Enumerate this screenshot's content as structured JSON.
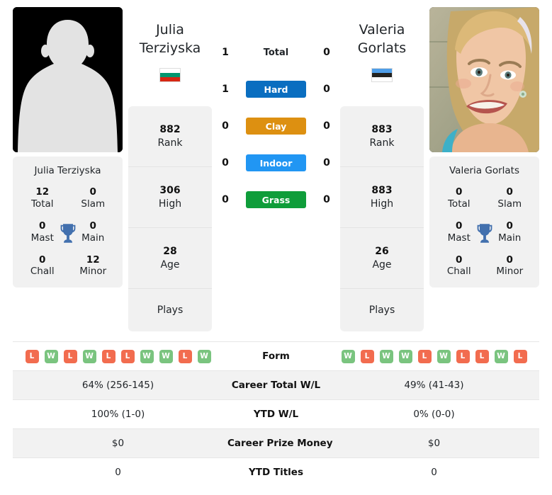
{
  "players": {
    "left": {
      "first_name": "Julia",
      "last_name": "Terziyska",
      "full_name": "Julia Terziyska",
      "country": "Bulgaria",
      "flag_icon": "flag-bulgaria-icon",
      "photo_type": "placeholder-avatar",
      "rank": "882",
      "rank_label": "Rank",
      "high": "306",
      "high_label": "High",
      "age": "28",
      "age_label": "Age",
      "plays_label": "Plays",
      "titles": {
        "total": "12",
        "total_label": "Total",
        "slam": "0",
        "slam_label": "Slam",
        "mast": "0",
        "mast_label": "Mast",
        "main": "0",
        "main_label": "Main",
        "chall": "0",
        "chall_label": "Chall",
        "minor": "12",
        "minor_label": "Minor"
      },
      "form": [
        "L",
        "W",
        "L",
        "W",
        "L",
        "L",
        "W",
        "W",
        "L",
        "W"
      ],
      "career_total_wl": "64% (256-145)",
      "ytd_wl": "100% (1-0)",
      "career_prize_money": "$0",
      "ytd_titles": "0"
    },
    "right": {
      "first_name": "Valeria",
      "last_name": "Gorlats",
      "full_name": "Valeria Gorlats",
      "country": "Estonia",
      "flag_icon": "flag-estonia-icon",
      "photo_type": "player-photo",
      "rank": "883",
      "rank_label": "Rank",
      "high": "883",
      "high_label": "High",
      "age": "26",
      "age_label": "Age",
      "plays_label": "Plays",
      "titles": {
        "total": "0",
        "total_label": "Total",
        "slam": "0",
        "slam_label": "Slam",
        "mast": "0",
        "mast_label": "Mast",
        "main": "0",
        "main_label": "Main",
        "chall": "0",
        "chall_label": "Chall",
        "minor": "0",
        "minor_label": "Minor"
      },
      "form": [
        "W",
        "L",
        "W",
        "W",
        "L",
        "W",
        "L",
        "L",
        "W",
        "L"
      ],
      "career_total_wl": "49% (41-43)",
      "ytd_wl": "0% (0-0)",
      "career_prize_money": "$0",
      "ytd_titles": "0"
    }
  },
  "head_to_head": {
    "rows": [
      {
        "key": "total",
        "label": "Total",
        "left": "1",
        "right": "0",
        "color": "",
        "style": "plain"
      },
      {
        "key": "hard",
        "label": "Hard",
        "left": "1",
        "right": "0",
        "color": "#0a6ec0",
        "style": "pill"
      },
      {
        "key": "clay",
        "label": "Clay",
        "left": "0",
        "right": "0",
        "color": "#dd9011",
        "style": "pill"
      },
      {
        "key": "indoor",
        "label": "Indoor",
        "left": "0",
        "right": "0",
        "color": "#2196f3",
        "style": "pill"
      },
      {
        "key": "grass",
        "label": "Grass",
        "left": "0",
        "right": "0",
        "color": "#0f9d3a",
        "style": "pill"
      }
    ]
  },
  "table": {
    "rows": [
      {
        "key": "form",
        "label": "Form",
        "type": "badges"
      },
      {
        "key": "career_total_wl",
        "label": "Career Total W/L",
        "type": "text"
      },
      {
        "key": "ytd_wl",
        "label": "YTD W/L",
        "type": "text"
      },
      {
        "key": "career_prize_money",
        "label": "Career Prize Money",
        "type": "text"
      },
      {
        "key": "ytd_titles",
        "label": "YTD Titles",
        "type": "text"
      }
    ]
  },
  "colors": {
    "win_badge": "#7ac47f",
    "loss_badge": "#f26c4f",
    "trophy": "#4270ae",
    "card_bg": "#f1f1f1",
    "alt_row_bg": "#f2f2f2"
  }
}
